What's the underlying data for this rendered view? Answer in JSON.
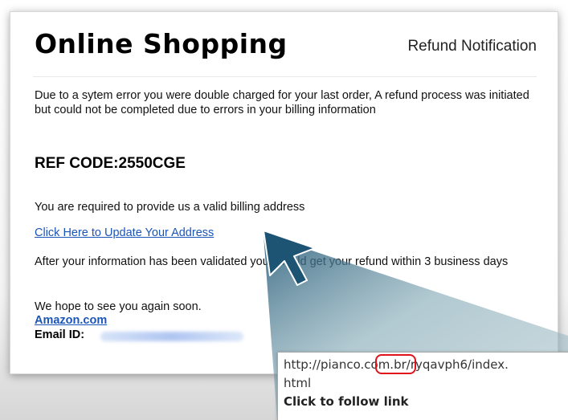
{
  "email": {
    "brand": "Online Shopping",
    "notification_title": "Refund Notification",
    "paragraph1": "Due to a sytem error you were double charged for your last order, A refund process was initiated but could not be completed due to errors in  your billing information",
    "ref_code": "REF CODE:2550CGE",
    "paragraph2": "You are required to provide us a valid billing address",
    "link_text": "Click Here to Update Your Address",
    "paragraph3": "After your information has been validated you should get your refund within 3 business days",
    "closing": "We hope to see you again soon.",
    "sender_link": "Amazon.com",
    "email_id_label": "Email ID:"
  },
  "tooltip": {
    "url_line1": "http://pianco.com.br/ryqavph6/index.",
    "url_line2": "html",
    "follow_hint": "Click to follow link"
  },
  "colors": {
    "link": "#1a55b8",
    "highlight": "#e0131a",
    "arrow": "#1e5473",
    "callout": "#6f9aa8"
  },
  "icons": {
    "cursor": "arrow-pointer-icon"
  }
}
